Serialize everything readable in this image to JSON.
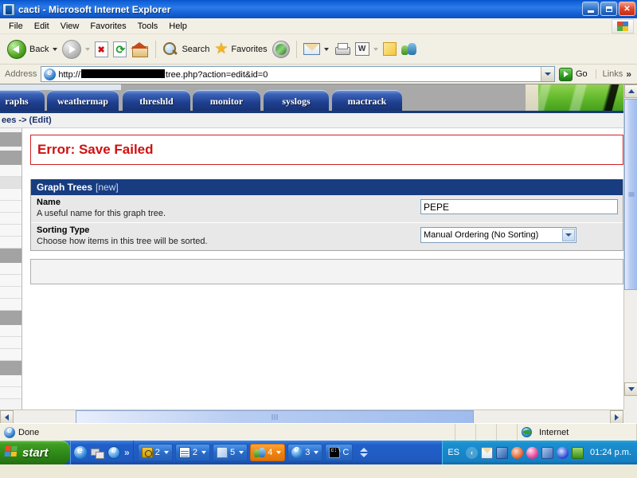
{
  "window": {
    "title": "cacti - Microsoft Internet Explorer",
    "icon": "ie-document-icon",
    "minimize": "_",
    "maximize": "❐",
    "close": "✕"
  },
  "menubar": {
    "items": [
      "File",
      "Edit",
      "View",
      "Favorites",
      "Tools",
      "Help"
    ]
  },
  "toolbar": {
    "back": "Back",
    "search": "Search",
    "favorites": "Favorites",
    "icons": [
      "back-icon",
      "forward-icon",
      "stop-icon",
      "refresh-icon",
      "home-icon",
      "search-icon",
      "favorites-star-icon",
      "media-icon",
      "mail-icon",
      "print-icon",
      "edit-icon",
      "notes-icon",
      "messenger-icon"
    ]
  },
  "address": {
    "label": "Address",
    "url_prefix": "http://",
    "url_suffix": "tree.php?action=edit&id=0",
    "redacted": true,
    "go_label": "Go",
    "links_label": "Links",
    "overflow": "»"
  },
  "cacti": {
    "tabs": [
      {
        "label": "raphs",
        "clipped": true,
        "highlight": false
      },
      {
        "label": "weathermap",
        "clipped": false,
        "highlight": true
      },
      {
        "label": "threshld",
        "clipped": false,
        "highlight": false
      },
      {
        "label": "monitor",
        "clipped": false,
        "highlight": false
      },
      {
        "label": "syslogs",
        "clipped": false,
        "highlight": false
      },
      {
        "label": "mactrack",
        "clipped": false,
        "highlight": false
      }
    ],
    "breadcrumb": "ees -> (Edit)",
    "logo": "cacti-green-banner"
  },
  "content": {
    "error": "Error: Save Failed",
    "panel": {
      "title": "Graph Trees",
      "subtitle": "[new]"
    },
    "fields": [
      {
        "label": "Name",
        "description": "A useful name for this graph tree.",
        "control": "text",
        "value": "PEPE"
      },
      {
        "label": "Sorting Type",
        "description": "Choose how items in this tree will be sorted.",
        "control": "select",
        "value": "Manual Ordering (No Sorting)"
      }
    ]
  },
  "statusbar": {
    "status": "Done",
    "zone": "Internet"
  },
  "taskbar": {
    "start": "start",
    "quicklaunch_overflow": "»",
    "buttons": [
      {
        "count": "2",
        "icon": "clock-icon",
        "active": false
      },
      {
        "count": "2",
        "icon": "window-icon",
        "active": false
      },
      {
        "count": "5",
        "icon": "note-icon",
        "active": false
      },
      {
        "count": "4",
        "icon": "people-icon",
        "active": true
      },
      {
        "count": "3",
        "icon": "ie-icon",
        "active": false
      },
      {
        "count": "C",
        "icon": "console-icon",
        "active": false
      }
    ],
    "language": "ES",
    "clock": "01:24 p.m.",
    "tray_icons": [
      "mail-icon",
      "network-icon",
      "antivirus-icon",
      "ball-icon",
      "network2-icon",
      "wave-icon",
      "monitor-icon"
    ]
  },
  "colors": {
    "titlebar": "#1560d4",
    "panel_header": "#173c80",
    "error_text": "#cf1111",
    "taskbar": "#215fc8",
    "start_green": "#3f9d23",
    "cacti_green": "#65bb2e"
  }
}
